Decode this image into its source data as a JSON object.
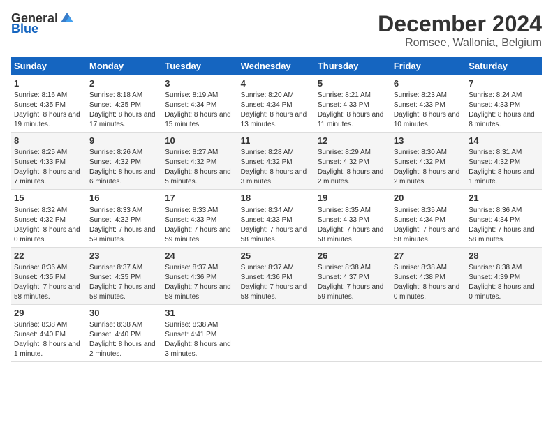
{
  "header": {
    "logo_general": "General",
    "logo_blue": "Blue",
    "month": "December 2024",
    "location": "Romsee, Wallonia, Belgium"
  },
  "days_of_week": [
    "Sunday",
    "Monday",
    "Tuesday",
    "Wednesday",
    "Thursday",
    "Friday",
    "Saturday"
  ],
  "weeks": [
    [
      {
        "day": "1",
        "sunrise": "8:16 AM",
        "sunset": "4:35 PM",
        "daylight": "8 hours and 19 minutes."
      },
      {
        "day": "2",
        "sunrise": "8:18 AM",
        "sunset": "4:35 PM",
        "daylight": "8 hours and 17 minutes."
      },
      {
        "day": "3",
        "sunrise": "8:19 AM",
        "sunset": "4:34 PM",
        "daylight": "8 hours and 15 minutes."
      },
      {
        "day": "4",
        "sunrise": "8:20 AM",
        "sunset": "4:34 PM",
        "daylight": "8 hours and 13 minutes."
      },
      {
        "day": "5",
        "sunrise": "8:21 AM",
        "sunset": "4:33 PM",
        "daylight": "8 hours and 11 minutes."
      },
      {
        "day": "6",
        "sunrise": "8:23 AM",
        "sunset": "4:33 PM",
        "daylight": "8 hours and 10 minutes."
      },
      {
        "day": "7",
        "sunrise": "8:24 AM",
        "sunset": "4:33 PM",
        "daylight": "8 hours and 8 minutes."
      }
    ],
    [
      {
        "day": "8",
        "sunrise": "8:25 AM",
        "sunset": "4:33 PM",
        "daylight": "8 hours and 7 minutes."
      },
      {
        "day": "9",
        "sunrise": "8:26 AM",
        "sunset": "4:32 PM",
        "daylight": "8 hours and 6 minutes."
      },
      {
        "day": "10",
        "sunrise": "8:27 AM",
        "sunset": "4:32 PM",
        "daylight": "8 hours and 5 minutes."
      },
      {
        "day": "11",
        "sunrise": "8:28 AM",
        "sunset": "4:32 PM",
        "daylight": "8 hours and 3 minutes."
      },
      {
        "day": "12",
        "sunrise": "8:29 AM",
        "sunset": "4:32 PM",
        "daylight": "8 hours and 2 minutes."
      },
      {
        "day": "13",
        "sunrise": "8:30 AM",
        "sunset": "4:32 PM",
        "daylight": "8 hours and 2 minutes."
      },
      {
        "day": "14",
        "sunrise": "8:31 AM",
        "sunset": "4:32 PM",
        "daylight": "8 hours and 1 minute."
      }
    ],
    [
      {
        "day": "15",
        "sunrise": "8:32 AM",
        "sunset": "4:32 PM",
        "daylight": "8 hours and 0 minutes."
      },
      {
        "day": "16",
        "sunrise": "8:33 AM",
        "sunset": "4:32 PM",
        "daylight": "7 hours and 59 minutes."
      },
      {
        "day": "17",
        "sunrise": "8:33 AM",
        "sunset": "4:33 PM",
        "daylight": "7 hours and 59 minutes."
      },
      {
        "day": "18",
        "sunrise": "8:34 AM",
        "sunset": "4:33 PM",
        "daylight": "7 hours and 58 minutes."
      },
      {
        "day": "19",
        "sunrise": "8:35 AM",
        "sunset": "4:33 PM",
        "daylight": "7 hours and 58 minutes."
      },
      {
        "day": "20",
        "sunrise": "8:35 AM",
        "sunset": "4:34 PM",
        "daylight": "7 hours and 58 minutes."
      },
      {
        "day": "21",
        "sunrise": "8:36 AM",
        "sunset": "4:34 PM",
        "daylight": "7 hours and 58 minutes."
      }
    ],
    [
      {
        "day": "22",
        "sunrise": "8:36 AM",
        "sunset": "4:35 PM",
        "daylight": "7 hours and 58 minutes."
      },
      {
        "day": "23",
        "sunrise": "8:37 AM",
        "sunset": "4:35 PM",
        "daylight": "7 hours and 58 minutes."
      },
      {
        "day": "24",
        "sunrise": "8:37 AM",
        "sunset": "4:36 PM",
        "daylight": "7 hours and 58 minutes."
      },
      {
        "day": "25",
        "sunrise": "8:37 AM",
        "sunset": "4:36 PM",
        "daylight": "7 hours and 58 minutes."
      },
      {
        "day": "26",
        "sunrise": "8:38 AM",
        "sunset": "4:37 PM",
        "daylight": "7 hours and 59 minutes."
      },
      {
        "day": "27",
        "sunrise": "8:38 AM",
        "sunset": "4:38 PM",
        "daylight": "8 hours and 0 minutes."
      },
      {
        "day": "28",
        "sunrise": "8:38 AM",
        "sunset": "4:39 PM",
        "daylight": "8 hours and 0 minutes."
      }
    ],
    [
      {
        "day": "29",
        "sunrise": "8:38 AM",
        "sunset": "4:40 PM",
        "daylight": "8 hours and 1 minute."
      },
      {
        "day": "30",
        "sunrise": "8:38 AM",
        "sunset": "4:40 PM",
        "daylight": "8 hours and 2 minutes."
      },
      {
        "day": "31",
        "sunrise": "8:38 AM",
        "sunset": "4:41 PM",
        "daylight": "8 hours and 3 minutes."
      },
      null,
      null,
      null,
      null
    ]
  ]
}
